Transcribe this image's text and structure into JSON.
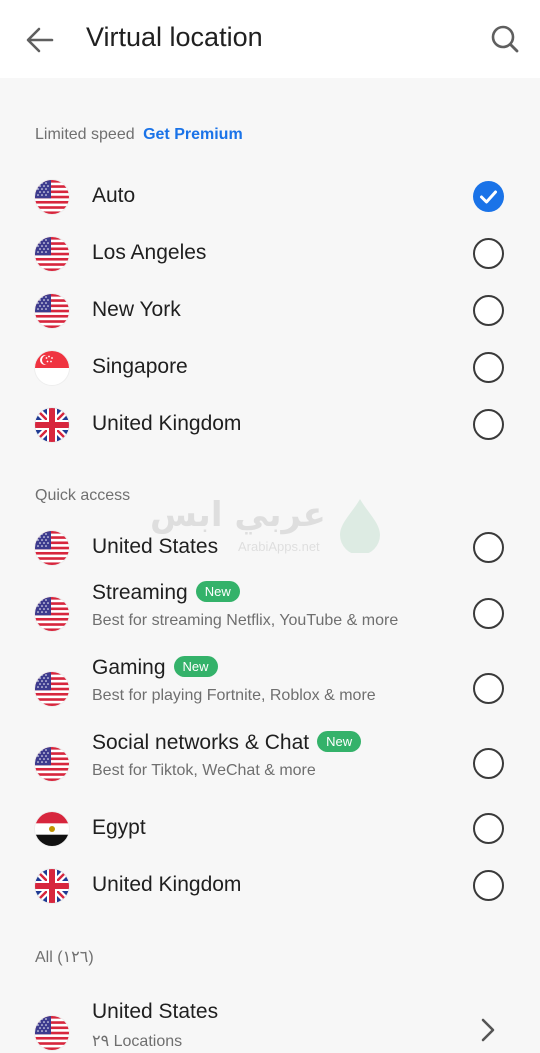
{
  "header": {
    "title": "Virtual location",
    "back_icon": "arrow-left-icon",
    "search_icon": "search-icon"
  },
  "sections": {
    "limited": {
      "label": "Limited speed",
      "link": "Get Premium",
      "items": [
        {
          "label": "Auto",
          "flag": "us",
          "checked": true
        },
        {
          "label": "Los Angeles",
          "flag": "us",
          "checked": false
        },
        {
          "label": "New York",
          "flag": "us",
          "checked": false
        },
        {
          "label": "Singapore",
          "flag": "sg",
          "checked": false
        },
        {
          "label": "United Kingdom",
          "flag": "uk",
          "checked": false
        }
      ]
    },
    "quick": {
      "label": "Quick access",
      "items": [
        {
          "label": "United States",
          "flag": "us"
        },
        {
          "label": "Streaming",
          "badge": "New",
          "sub": "Best for streaming Netflix, YouTube & more",
          "flag": "us"
        },
        {
          "label": "Gaming",
          "badge": "New",
          "sub": "Best for playing Fortnite, Roblox & more",
          "flag": "us"
        },
        {
          "label": "Social networks & Chat",
          "badge": "New",
          "sub": "Best for Tiktok, WeChat & more",
          "flag": "us"
        },
        {
          "label": "Egypt",
          "flag": "eg"
        },
        {
          "label": "United Kingdom",
          "flag": "uk"
        }
      ]
    },
    "all": {
      "label": "All (١٢٦)",
      "items": [
        {
          "label": "United States",
          "sub": "٢٩ Locations",
          "flag": "us"
        }
      ]
    }
  },
  "watermark": {
    "text": "عربي ابس",
    "sub": "ArabiApps.net"
  },
  "colors": {
    "accent": "#1a73e8",
    "badge": "#34b26a"
  }
}
